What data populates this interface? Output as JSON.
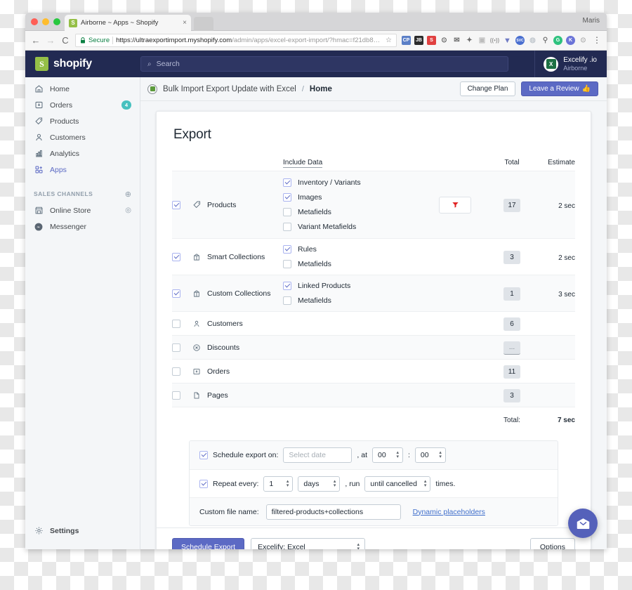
{
  "browser": {
    "tab_title": "Airborne ~ Apps ~ Shopify",
    "tab_close": "×",
    "profile_name": "Maris",
    "back_arrow": "←",
    "forward_arrow": "→",
    "reload": "C",
    "lock_icon": "lock-icon",
    "secure_label": "Secure",
    "url_bold": "https://ultraexportimport.myshopify.com",
    "url_rest": "/admin/apps/excel-export-import/?hmac=f21db8…",
    "star": "☆",
    "menu_dots": "⋮",
    "extensions": [
      "clipboard-icon",
      "jb-icon",
      "shopify-icon",
      "camera-icon",
      "mail-icon",
      "pin-icon",
      "screenshot-icon",
      "wave-icon",
      "v-icon",
      "svc-icon",
      "drop-icon",
      "runner-icon",
      "g-icon",
      "k-icon",
      "info-icon"
    ]
  },
  "topbar": {
    "logo_glyph": "S",
    "wordmark": "shopify",
    "search_icon": "search-icon",
    "search_placeholder": "Search",
    "account_glyph": "X",
    "account_name": "Excelify .io",
    "account_store": "Airborne"
  },
  "sidebar": {
    "items": [
      {
        "label": "Home",
        "icon": "home-icon",
        "badge": "",
        "active": false
      },
      {
        "label": "Orders",
        "icon": "orders-icon",
        "badge": "4",
        "active": false
      },
      {
        "label": "Products",
        "icon": "tag-icon",
        "badge": "",
        "active": false
      },
      {
        "label": "Customers",
        "icon": "customer-icon",
        "badge": "",
        "active": false
      },
      {
        "label": "Analytics",
        "icon": "analytics-icon",
        "badge": "",
        "active": false
      },
      {
        "label": "Apps",
        "icon": "apps-icon",
        "badge": "",
        "active": true
      }
    ],
    "section_label": "SALES CHANNELS",
    "section_add": "⊕",
    "channels": [
      {
        "label": "Online Store",
        "icon": "store-icon",
        "action": "◎"
      },
      {
        "label": "Messenger",
        "icon": "messenger-icon",
        "action": ""
      }
    ],
    "settings_label": "Settings",
    "settings_icon": "gear-icon"
  },
  "page_header": {
    "app_icon": "excel-app-icon",
    "breadcrumb_app": "Bulk Import Export Update with Excel",
    "breadcrumb_sep": "/",
    "breadcrumb_page": "Home",
    "change_plan_label": "Change Plan",
    "leave_review_label": "Leave a Review",
    "leave_review_emoji": "👍"
  },
  "export": {
    "title": "Export",
    "columns": {
      "include_data": "Include Data",
      "total": "Total",
      "estimate": "Estimate"
    },
    "rows": [
      {
        "name": "Products",
        "icon": "tag-icon",
        "checked": true,
        "shaded": true,
        "sub": [
          {
            "label": "Inventory / Variants",
            "checked": true
          },
          {
            "label": "Images",
            "checked": true
          },
          {
            "label": "Metafields",
            "checked": false
          },
          {
            "label": "Variant Metafields",
            "checked": false
          }
        ],
        "has_filter": true,
        "filter_icon": "funnel-icon",
        "total": "17",
        "estimate": "2 sec"
      },
      {
        "name": "Smart Collections",
        "icon": "collection-icon",
        "checked": true,
        "shaded": false,
        "sub": [
          {
            "label": "Rules",
            "checked": true
          },
          {
            "label": "Metafields",
            "checked": false
          }
        ],
        "has_filter": false,
        "filter_icon": "",
        "total": "3",
        "estimate": "2 sec"
      },
      {
        "name": "Custom Collections",
        "icon": "collection-icon",
        "checked": true,
        "shaded": true,
        "sub": [
          {
            "label": "Linked Products",
            "checked": true
          },
          {
            "label": "Metafields",
            "checked": false
          }
        ],
        "has_filter": false,
        "filter_icon": "",
        "total": "1",
        "estimate": "3 sec"
      },
      {
        "name": "Customers",
        "icon": "customer-icon",
        "checked": false,
        "shaded": false,
        "sub": [],
        "has_filter": false,
        "filter_icon": "",
        "total": "6",
        "estimate": ""
      },
      {
        "name": "Discounts",
        "icon": "discount-icon",
        "checked": false,
        "shaded": true,
        "sub": [],
        "has_filter": false,
        "filter_icon": "",
        "total": "...",
        "estimate": ""
      },
      {
        "name": "Orders",
        "icon": "orders-icon",
        "checked": false,
        "shaded": false,
        "sub": [],
        "has_filter": false,
        "filter_icon": "",
        "total": "11",
        "estimate": ""
      },
      {
        "name": "Pages",
        "icon": "page-icon",
        "checked": false,
        "shaded": true,
        "sub": [],
        "has_filter": false,
        "filter_icon": "",
        "total": "3",
        "estimate": ""
      }
    ],
    "total_label": "Total:",
    "total_value": "7 sec"
  },
  "schedule": {
    "export_on_checked": true,
    "export_on_label": "Schedule export on:",
    "date_placeholder": "Select date",
    "at_label": ", at",
    "hour_value": "00",
    "time_sep": ":",
    "minute_value": "00",
    "repeat_checked": true,
    "repeat_label": "Repeat every:",
    "interval_value": "1",
    "unit_value": "days",
    "run_label": ", run",
    "times_value": "until cancelled",
    "times_label": "times.",
    "file_name_label": "Custom file name:",
    "file_name_value": "filtered-products+collections",
    "dynamic_placeholders": "Dynamic placeholders"
  },
  "footer": {
    "schedule_export_label": "Schedule Export",
    "format_value": "Excelify: Excel",
    "options_label": "Options"
  },
  "chat": {
    "icon": "chat-envelope-icon"
  },
  "colors": {
    "shopify_navy": "#222a52",
    "shopify_green": "#95bf47",
    "accent_indigo": "#5c6ac4",
    "badge_teal": "#47c1bf",
    "filter_red": "#e02020",
    "link_blue": "#3f6ecb"
  }
}
